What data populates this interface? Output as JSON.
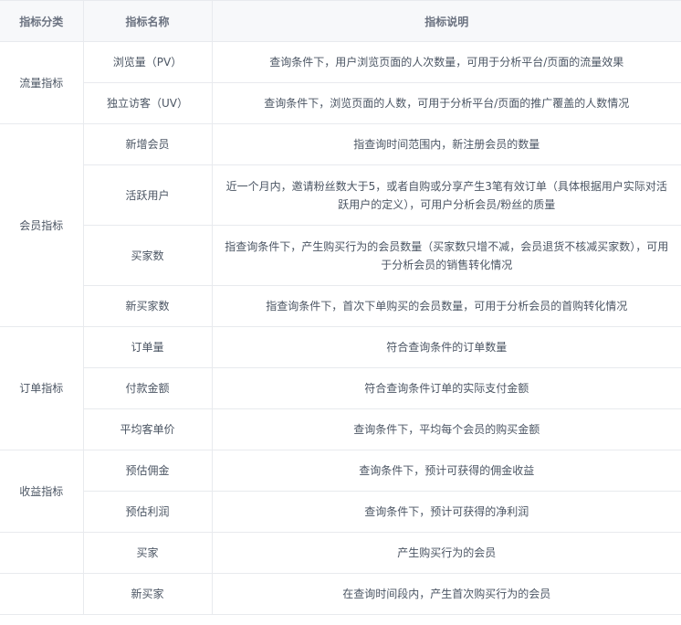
{
  "headers": [
    "指标分类",
    "指标名称",
    "指标说明"
  ],
  "groups": {
    "traffic": "流量指标",
    "member": "会员指标",
    "order": "订单指标",
    "revenue": "收益指标"
  },
  "rows": [
    {
      "name": "浏览量（PV）",
      "desc": "查询条件下，用户浏览页面的人次数量，可用于分析平台/页面的流量效果"
    },
    {
      "name": "独立访客（UV）",
      "desc": "查询条件下，浏览页面的人数，可用于分析平台/页面的推广覆盖的人数情况"
    },
    {
      "name": "新增会员",
      "desc": "指查询时间范围内，新注册会员的数量"
    },
    {
      "name": "活跃用户",
      "desc": "近一个月内，邀请粉丝数大于5，或者自购或分享产生3笔有效订单（具体根据用户实际对活跃用户的定义），可用户分析会员/粉丝的质量"
    },
    {
      "name": "买家数",
      "desc": "指查询条件下，产生购买行为的会员数量（买家数只增不减，会员退货不核减买家数），可用于分析会员的销售转化情况"
    },
    {
      "name": "新买家数",
      "desc": "指查询条件下，首次下单购买的会员数量，可用于分析会员的首购转化情况"
    },
    {
      "name": "订单量",
      "desc": "符合查询条件的订单数量"
    },
    {
      "name": "付款金额",
      "desc": "符合查询条件订单的实际支付金额"
    },
    {
      "name": "平均客单价",
      "desc": "查询条件下，平均每个会员的购买金额"
    },
    {
      "name": "预估佣金",
      "desc": "查询条件下，预计可获得的佣金收益"
    },
    {
      "name": "预估利润",
      "desc": "查询条件下，预计可获得的净利润"
    },
    {
      "name": "买家",
      "desc": "产生购买行为的会员"
    },
    {
      "name": "新买家",
      "desc": "在查询时间段内，产生首次购买行为的会员"
    }
  ]
}
